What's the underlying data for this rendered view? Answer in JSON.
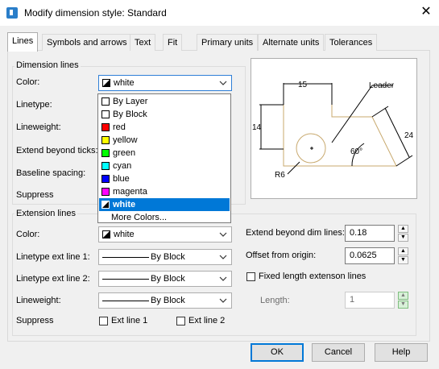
{
  "window": {
    "title": "Modify dimension style: Standard",
    "close_glyph": "✕"
  },
  "tabs": [
    {
      "label": "Lines",
      "active": true
    },
    {
      "label": "Symbols and arrows"
    },
    {
      "label": "Text"
    },
    {
      "label": "Fit"
    },
    {
      "label": "Primary units"
    },
    {
      "label": "Alternate units"
    },
    {
      "label": "Tolerances"
    }
  ],
  "dimension_lines": {
    "group_label": "Dimension lines",
    "color_label": "Color:",
    "color_value": "white",
    "linetype_label": "Linetype:",
    "lineweight_label": "Lineweight:",
    "extend_beyond_ticks_label": "Extend beyond ticks:",
    "baseline_spacing_label": "Baseline spacing:",
    "suppress_label": "Suppress"
  },
  "color_dropdown": {
    "items": [
      {
        "label": "By Layer",
        "color": "#ffffff"
      },
      {
        "label": "By Block",
        "color": "#ffffff"
      },
      {
        "label": "red",
        "color": "#ff0000"
      },
      {
        "label": "yellow",
        "color": "#ffff00"
      },
      {
        "label": "green",
        "color": "#00ff00"
      },
      {
        "label": "cyan",
        "color": "#00ffff"
      },
      {
        "label": "blue",
        "color": "#0000ff"
      },
      {
        "label": "magenta",
        "color": "#ff00ff"
      },
      {
        "label": "white",
        "color": "#ffffff",
        "selected": true
      },
      {
        "label": "More Colors...",
        "color": ""
      }
    ]
  },
  "extension_lines": {
    "group_label": "Extension lines",
    "color_label": "Color:",
    "color_value": "white",
    "linetype_ext1_label": "Linetype ext line 1:",
    "linetype_ext1_value": "By Block",
    "linetype_ext2_label": "Linetype ext line 2:",
    "linetype_ext2_value": "By Block",
    "lineweight_label": "Lineweight:",
    "lineweight_value": "By Block",
    "suppress_label": "Suppress",
    "ext_line1_label": "Ext line 1",
    "ext_line2_label": "Ext line 2",
    "extend_beyond_dim_label": "Extend beyond dim lines:",
    "extend_beyond_dim_value": "0.18",
    "offset_origin_label": "Offset from origin:",
    "offset_origin_value": "0.0625",
    "fixed_length_label": "Fixed length extenson lines",
    "length_label": "Length:",
    "length_value": "1"
  },
  "preview": {
    "dim_top": "15",
    "dim_left": "14",
    "dim_right": "24",
    "angle": "60°",
    "radius": "R6",
    "leader": "Leader"
  },
  "buttons": {
    "ok": "OK",
    "cancel": "Cancel",
    "help": "Help"
  }
}
